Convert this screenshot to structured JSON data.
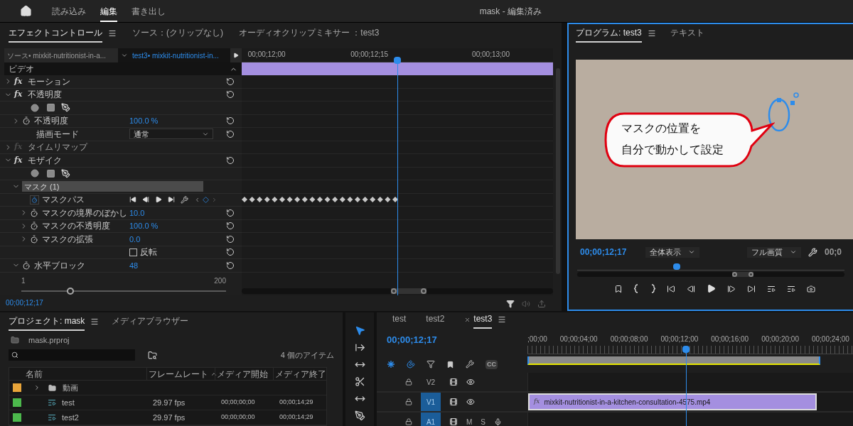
{
  "app_bar": {
    "nav": [
      {
        "label": "読み込み",
        "selected": false
      },
      {
        "label": "編集",
        "selected": true
      },
      {
        "label": "書き出し",
        "selected": false
      }
    ],
    "title": "mask - 編集済み"
  },
  "effect_controls": {
    "tabs": [
      {
        "label": "エフェクトコントロール",
        "selected": true
      },
      {
        "label": "ソース：(クリップなし)",
        "selected": false
      },
      {
        "label": "オーディオクリップミキサー ：test3",
        "selected": false
      }
    ],
    "source": "ソース• mixkit-nutritionist-in-a...",
    "clip": "test3• mixkit-nutritionist-in...",
    "ruler": [
      "00;00;12;00",
      "00;00;12;15",
      "00;00;13;00"
    ],
    "playhead": {
      "level": 0.5
    },
    "section": "ビデオ",
    "effects": [
      {
        "kind": "effect",
        "fx": "fx",
        "label": "モーション",
        "expanded": false,
        "enabled": true
      },
      {
        "kind": "effect",
        "fx": "fx",
        "label": "不透明度",
        "expanded": true,
        "enabled": true,
        "children": [
          {
            "kind": "mask_tools"
          },
          {
            "kind": "param",
            "label": "不透明度",
            "value": "100.0 %",
            "expanded": false,
            "animated": false
          },
          {
            "kind": "select",
            "label": "描画モード",
            "value": "通常"
          }
        ]
      },
      {
        "kind": "effect",
        "fx": "fx",
        "label": "タイムリマップ",
        "expanded": false,
        "enabled": false
      },
      {
        "kind": "effect",
        "fx": "fx",
        "label": "モザイク",
        "expanded": true,
        "enabled": true,
        "children": [
          {
            "kind": "mask_tools"
          },
          {
            "kind": "mask",
            "label": "マスク (1)",
            "expanded": true,
            "children": [
              {
                "kind": "mask_path",
                "label": "マスクパス",
                "animated": true
              },
              {
                "kind": "param",
                "label": "マスクの境界のぼかし",
                "value": "10.0",
                "expanded": false,
                "animated": false
              },
              {
                "kind": "param",
                "label": "マスクの不透明度",
                "value": "100.0 %",
                "expanded": false,
                "animated": false
              },
              {
                "kind": "param",
                "label": "マスクの拡張",
                "value": "0.0",
                "expanded": false,
                "animated": false
              },
              {
                "kind": "checkbox",
                "label": "反転",
                "checked": false
              }
            ]
          },
          {
            "kind": "param",
            "label": "水平ブロック",
            "value": "48",
            "expanded": true,
            "animated": false,
            "range_min": "1",
            "range_max": "200",
            "level": 0.24
          }
        ]
      }
    ],
    "timecode": "00;00;12;17"
  },
  "program": {
    "tabs": [
      {
        "label": "プログラム: test3",
        "selected": true
      },
      {
        "label": "テキスト",
        "selected": false
      }
    ],
    "callout": [
      "マスクの位置を",
      "自分で動かして設定"
    ],
    "timecode": "00;00;12;17",
    "zoom": "全体表示",
    "quality": "フル画質",
    "duration": "00;0",
    "playhead": {
      "level": 0.36
    }
  },
  "project": {
    "tabs": [
      {
        "label": "プロジェクト: mask",
        "selected": true
      },
      {
        "label": "メディアブラウザー",
        "selected": false
      }
    ],
    "file": "mask.prproj",
    "item_count": "4 個のアイテム",
    "columns": [
      "名前",
      "フレームレート",
      "メディア開始",
      "メディア終了"
    ],
    "rows": [
      {
        "kind": "bin",
        "name": "動画",
        "color": "#e9a53a",
        "expanded": false
      },
      {
        "kind": "sequence",
        "name": "test",
        "frame_rate": "29.97 fps",
        "media_start": "00;00;00;00",
        "media_end": "00;00;14;29",
        "color": "#4cb84c"
      },
      {
        "kind": "sequence",
        "name": "test2",
        "frame_rate": "29.97 fps",
        "media_start": "00;00;00;00",
        "media_end": "00;00;14;29",
        "color": "#4cb84c"
      }
    ]
  },
  "tools": [
    {
      "kind": "selection",
      "selected": true
    },
    {
      "kind": "track_select",
      "selected": false
    },
    {
      "kind": "ripple",
      "selected": false
    },
    {
      "kind": "razor",
      "selected": false
    },
    {
      "kind": "slip",
      "selected": false
    },
    {
      "kind": "pen",
      "selected": false
    }
  ],
  "timeline": {
    "tabs": [
      {
        "label": "test",
        "selected": false
      },
      {
        "label": "test2",
        "selected": false
      },
      {
        "label": "test3",
        "selected": true
      }
    ],
    "timecode": "00;00;12;17",
    "captions": "CC",
    "ruler": [
      ";00;00",
      "00;00;04;00",
      "00;00;08;00",
      "00;00;12;00",
      "00;00;16;00",
      "00;00;20;00",
      "00;00;24;00"
    ],
    "playhead": {
      "level": 0.487
    },
    "tracks": [
      {
        "name": "V2",
        "kind": "video",
        "targeted": false
      },
      {
        "name": "V1",
        "kind": "video",
        "targeted": true,
        "clip": "mixkit-nutritionist-in-a-kitchen-consultation-4575.mp4",
        "clip_fx": "fx"
      },
      {
        "name": "A1",
        "kind": "audio",
        "targeted": true,
        "mute": "M",
        "solo": "S"
      }
    ]
  }
}
